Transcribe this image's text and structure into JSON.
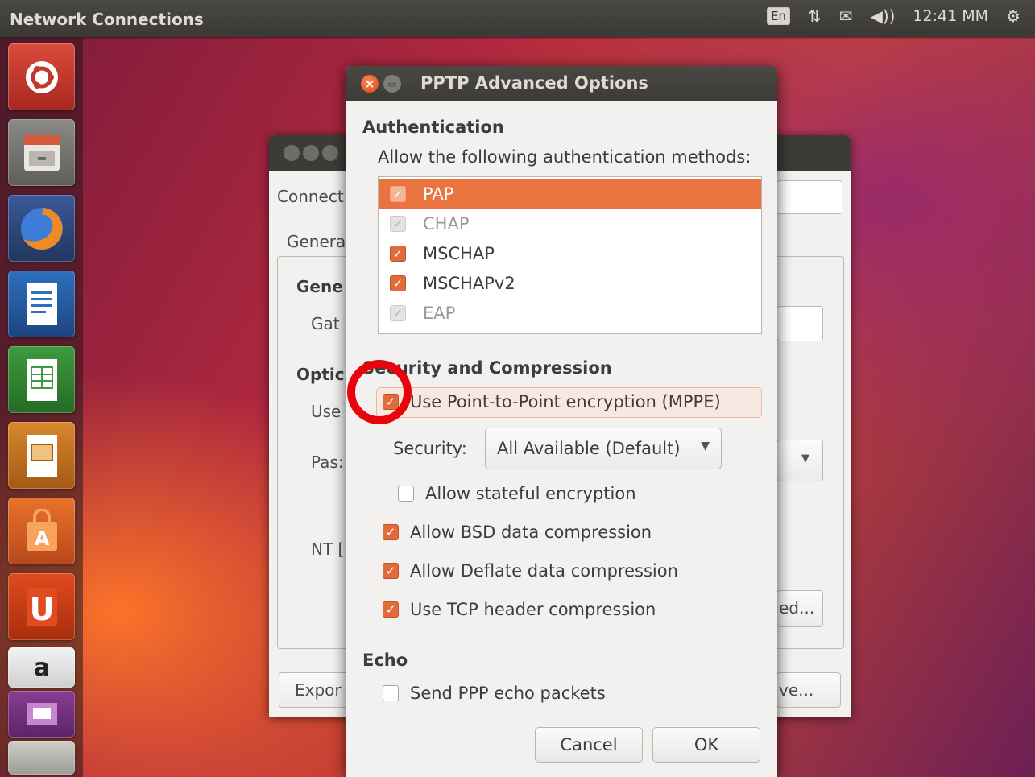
{
  "top_panel": {
    "app_title": "Network Connections",
    "keyboard": "En",
    "network_icon": "network-arrows-icon",
    "mail_icon": "envelope-icon",
    "volume": "◀))",
    "clock": "12:41 MM",
    "settings_icon": "gear-icon"
  },
  "launcher": {
    "items": [
      "dash-home",
      "files",
      "firefox",
      "libreoffice-writer",
      "libreoffice-calc",
      "libreoffice-impress",
      "ubuntu-software-center",
      "ubuntu-one",
      "amazon",
      "workspaces"
    ]
  },
  "background_window": {
    "connection_label": "Connect",
    "tab_general": "Genera",
    "section_general": "Gene",
    "gateway_label": "Gat",
    "section_optional": "Optic",
    "user_label": "Use",
    "password_label": "Pas:",
    "nt_label": "NT [",
    "advanced_button": "ed...",
    "export_button": "Expor",
    "save_button": "ve..."
  },
  "dialog": {
    "title": "PPTP Advanced Options",
    "auth_section": "Authentication",
    "auth_hint": "Allow the following authentication methods:",
    "auth_methods": [
      {
        "label": "PAP",
        "checked": true
      },
      {
        "label": "CHAP",
        "checked": true
      },
      {
        "label": "MSCHAP",
        "checked": true
      },
      {
        "label": "MSCHAPv2",
        "checked": true
      },
      {
        "label": "EAP",
        "checked": true
      }
    ],
    "security_section": "Security and Compression",
    "mppe_label": "Use Point-to-Point encryption (MPPE)",
    "security_label": "Security:",
    "security_value": "All Available (Default)",
    "stateful_label": "Allow stateful encryption",
    "bsd_label": "Allow BSD data compression",
    "deflate_label": "Allow Deflate data compression",
    "tcp_label": "Use TCP header compression",
    "echo_section": "Echo",
    "echo_label": "Send PPP echo packets",
    "cancel": "Cancel",
    "ok": "OK"
  },
  "colors": {
    "accent": "#e16b39",
    "selection": "#e9743f",
    "highlight_circle": "#e8040b",
    "titlebar": "#3c3b37"
  }
}
